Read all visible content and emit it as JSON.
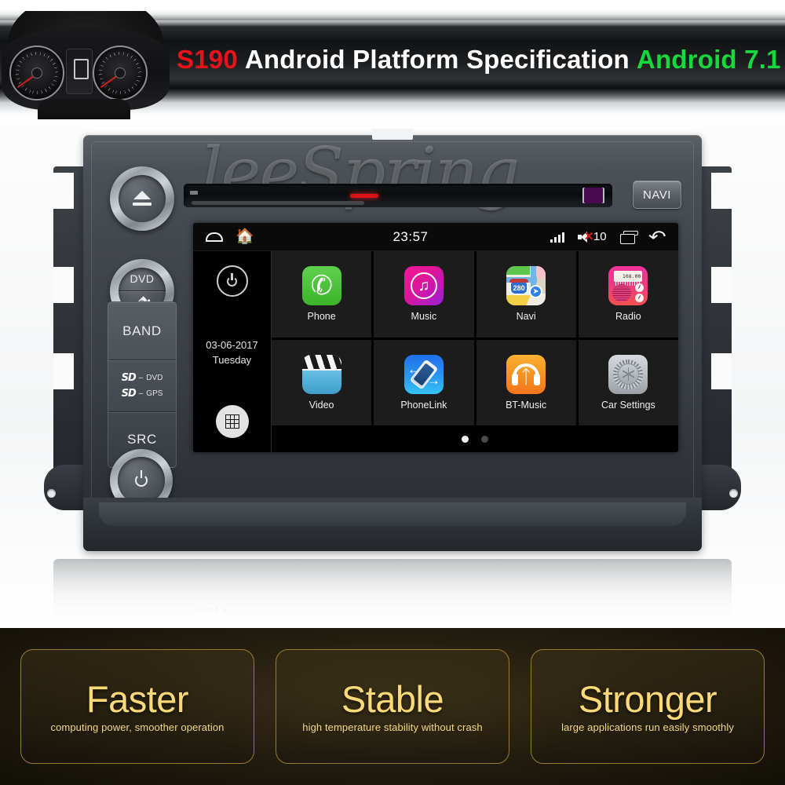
{
  "banner": {
    "model": "S190",
    "title": "Android Platform Specification",
    "version": "Android 7.1",
    "colors": {
      "model": "#e8121b",
      "title": "#ffffff",
      "version": "#17d83c"
    }
  },
  "unit": {
    "watermark": "leeSpring",
    "navi_button": "NAVI",
    "vol_label": "– VOL +",
    "buttons": {
      "eject": "eject",
      "dvd": "DVD",
      "hangup": "hang-up",
      "band": "BAND",
      "src": "SRC",
      "power": "power"
    },
    "sd_slots": [
      {
        "logo": "SD",
        "dash": "–",
        "label": "DVD"
      },
      {
        "logo": "SD",
        "dash": "–",
        "label": "GPS"
      }
    ]
  },
  "screen": {
    "statusbar": {
      "clock": "23:57",
      "volume": "10",
      "icons": [
        "nav-home-icon",
        "house-icon",
        "signal-bars-icon",
        "volume-mute-icon",
        "recents-icon",
        "back-icon"
      ]
    },
    "rail": {
      "power_icon": "power-icon",
      "date": "03-06-2017",
      "weekday": "Tuesday",
      "apps_icon": "app-drawer-icon"
    },
    "apps": [
      {
        "label": "Phone",
        "icon": "phone-icon",
        "color": "#4ac437"
      },
      {
        "label": "Music",
        "icon": "music-note-icon",
        "color": "#e01597"
      },
      {
        "label": "Navi",
        "icon": "map-icon",
        "color": "#f0ece3"
      },
      {
        "label": "Radio",
        "icon": "radio-icon",
        "color": "#f0319b",
        "freq": "108.00"
      },
      {
        "label": "Video",
        "icon": "clapperboard-icon",
        "color": "#5bb6dd"
      },
      {
        "label": "PhoneLink",
        "icon": "phone-link-icon",
        "color": "#2a9bf0"
      },
      {
        "label": "BT-Music",
        "icon": "bluetooth-headset-icon",
        "color": "#f79322"
      },
      {
        "label": "Car Settings",
        "icon": "gear-icon",
        "color": "#b7bcc1"
      }
    ],
    "page_dots": {
      "count": 2,
      "active": 0
    }
  },
  "features": [
    {
      "title": "Faster",
      "subtitle": "computing power, smoother operation"
    },
    {
      "title": "Stable",
      "subtitle": "high temperature stability without crash"
    },
    {
      "title": "Stronger",
      "subtitle": "large applications run easily smoothly"
    }
  ]
}
